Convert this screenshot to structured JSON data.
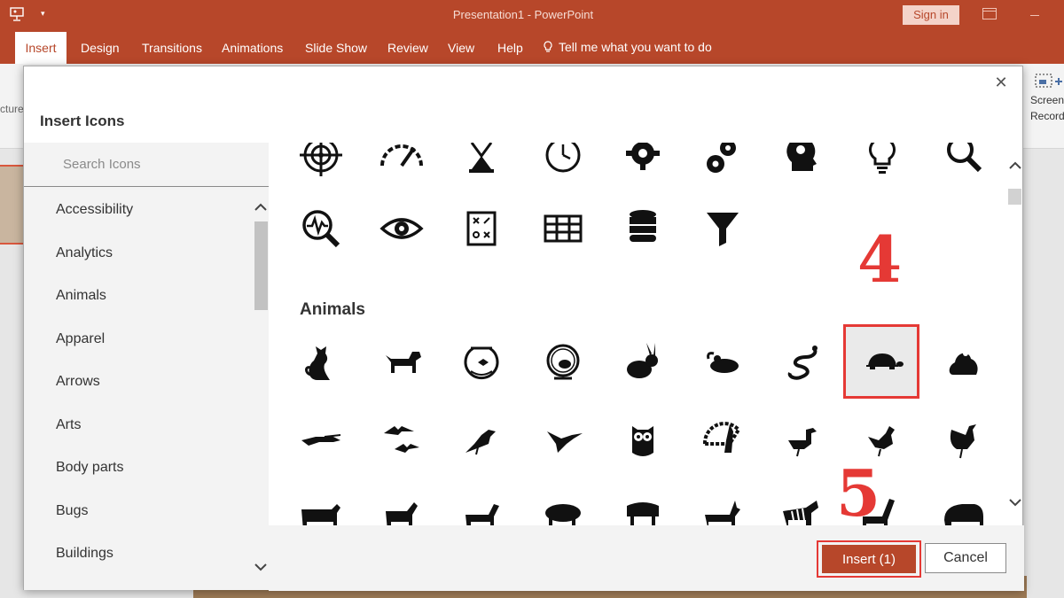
{
  "window": {
    "title": "Presentation1  -  PowerPoint",
    "sign_in": "Sign in"
  },
  "ribbon": {
    "tabs": [
      "Insert",
      "Design",
      "Transitions",
      "Animations",
      "Slide Show",
      "Review",
      "View",
      "Help"
    ],
    "tell_me": "Tell me what you want to do",
    "left_group_label": "cture",
    "right_group_label_1": "Screen",
    "right_group_label_2": "Recording"
  },
  "dialog": {
    "title": "Insert Icons",
    "close_symbol": "✕",
    "search_placeholder": "Search Icons",
    "categories": [
      "Accessibility",
      "Analytics",
      "Animals",
      "Apparel",
      "Arrows",
      "Arts",
      "Body parts",
      "Bugs",
      "Buildings"
    ],
    "section_label": "Animals",
    "insert_label": "Insert (1)",
    "cancel_label": "Cancel"
  },
  "analytics_icons_row1": [
    "target-icon",
    "speedometer-icon",
    "hourglass-icon",
    "clock-icon",
    "gear-icon",
    "gears-icon",
    "head-gear-icon",
    "lightbulb-icon",
    "magnifier-icon"
  ],
  "analytics_icons_row2": [
    "magnifier-pulse-icon",
    "eye-icon",
    "strategy-board-icon",
    "table-grid-icon",
    "database-icon",
    "funnel-icon"
  ],
  "animals_icons_row1": [
    "cat-icon",
    "dog-icon",
    "fishbowl-icon",
    "hamster-wheel-icon",
    "rabbit-icon",
    "mouse-icon",
    "snake-icon",
    "turtle-icon",
    "frog-icon"
  ],
  "animals_icons_row2": [
    "crocodile-icon",
    "bats-icon",
    "crow-icon",
    "hummingbird-icon",
    "owl-icon",
    "peacock-icon",
    "duck-icon",
    "chicken-icon",
    "rooster-icon"
  ],
  "animals_icons_row3": [
    "cow-icon",
    "goat-icon",
    "horse-icon",
    "pig-icon",
    "sheep-icon",
    "antelope-icon",
    "zebra-icon",
    "giraffe-icon",
    "elephant-icon"
  ],
  "selected_icon": "turtle-icon",
  "annotations": {
    "step_4": "4",
    "step_5": "5"
  },
  "colors": {
    "accent": "#b7472a",
    "annotation": "#e53935"
  }
}
